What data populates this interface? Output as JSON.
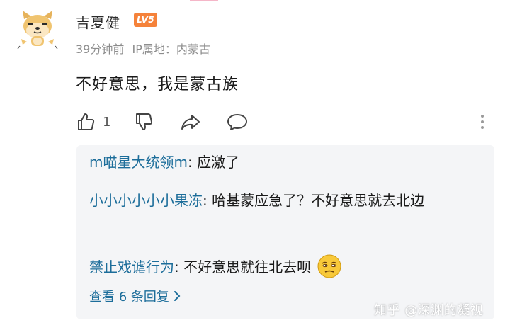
{
  "comment": {
    "username": "吉夏健",
    "level_badge": "LV5",
    "time": "39分钟前",
    "location_label": "IP属地：",
    "location": "内蒙古",
    "text": "不好意思，我是蒙古族",
    "like_count": "1"
  },
  "replies": [
    {
      "name": "m喵星大统领m",
      "separator": ": ",
      "text": "应激了"
    },
    {
      "name": "小小小小小小果冻",
      "separator": ": ",
      "text": "哈基蒙应急了？不好意思就去北边"
    },
    {
      "name": "禁止戏谑行为",
      "separator": ": ",
      "text": "不好意思就往北去呗"
    }
  ],
  "view_more": {
    "label": "查看 6 条回复",
    "icon": "chevron-right-icon"
  },
  "watermark": "知乎 @深渊的凝视",
  "colors": {
    "accent_link": "#1c6d9a",
    "badge": "#f5823a",
    "reply_bg": "#f4f5f7",
    "meta_text": "#8d8d8d"
  },
  "icons": [
    "thumbs-up-icon",
    "thumbs-down-icon",
    "share-icon",
    "reply-bubble-icon",
    "more-vertical-icon"
  ]
}
